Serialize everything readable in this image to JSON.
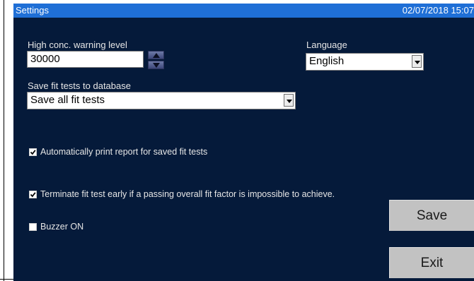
{
  "window": {
    "title": "Settings",
    "datetime": "02/07/2018 15:07"
  },
  "warning": {
    "label": "High conc. warning level",
    "value": "30000"
  },
  "language": {
    "label": "Language",
    "value": "English"
  },
  "save_fit": {
    "label": "Save fit tests to database",
    "value": "Save all fit tests"
  },
  "options": {
    "auto_print": {
      "label": "Automatically print report for saved fit tests",
      "checked": true
    },
    "terminate_early": {
      "label": "Terminate fit test early if a passing overall fit factor is impossible to achieve.",
      "checked": true
    },
    "buzzer": {
      "label": "Buzzer ON",
      "checked": false
    }
  },
  "buttons": {
    "save": "Save",
    "exit": "Exit"
  },
  "colors": {
    "background": "#051a3a",
    "titlebar": "#1f6fd6",
    "button": "#c2c2c2"
  },
  "icons": {
    "spin_up": "triangle-up-icon",
    "spin_down": "triangle-down-icon",
    "dropdown": "chevron-down-icon",
    "check": "checkmark-icon"
  }
}
